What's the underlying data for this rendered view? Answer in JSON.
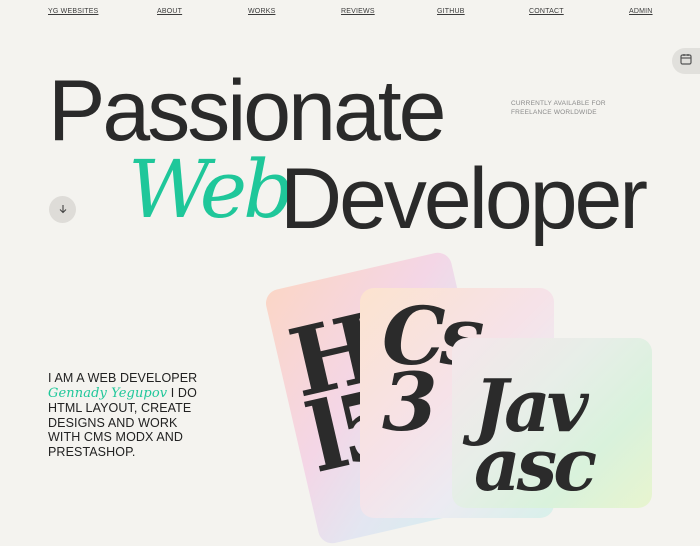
{
  "nav": {
    "items": [
      {
        "label": "YG WEBSITES"
      },
      {
        "label": "ABOUT"
      },
      {
        "label": "WORKS"
      },
      {
        "label": "REVIEWS"
      },
      {
        "label": "GITHUB"
      },
      {
        "label": "CONTACT"
      },
      {
        "label": "ADMIN"
      }
    ]
  },
  "hero": {
    "line1": "Passionate",
    "script_word": "Web",
    "line2": "Developer",
    "availability": "CURRENTLY AVAILABLE FOR FREELANCE WORLDWIDE"
  },
  "intro": {
    "before": "I AM A WEB DEVELOPER ",
    "name": "Gennady Yegupov",
    "after": " I DO HTML LAYOUT, CREATE DESIGNS AND WORK WITH CMS MODX AND PRESTASHOP."
  },
  "cards": [
    {
      "text": "Htm\nl5"
    },
    {
      "text": "Cs\n3"
    },
    {
      "text": "Jav\nasc"
    }
  ],
  "icons": {
    "scroll": "arrow-down-icon",
    "side": "calendar-icon"
  },
  "colors": {
    "accent": "#1fc79a",
    "background": "#f4f3ef",
    "text": "#2a2a2a"
  }
}
